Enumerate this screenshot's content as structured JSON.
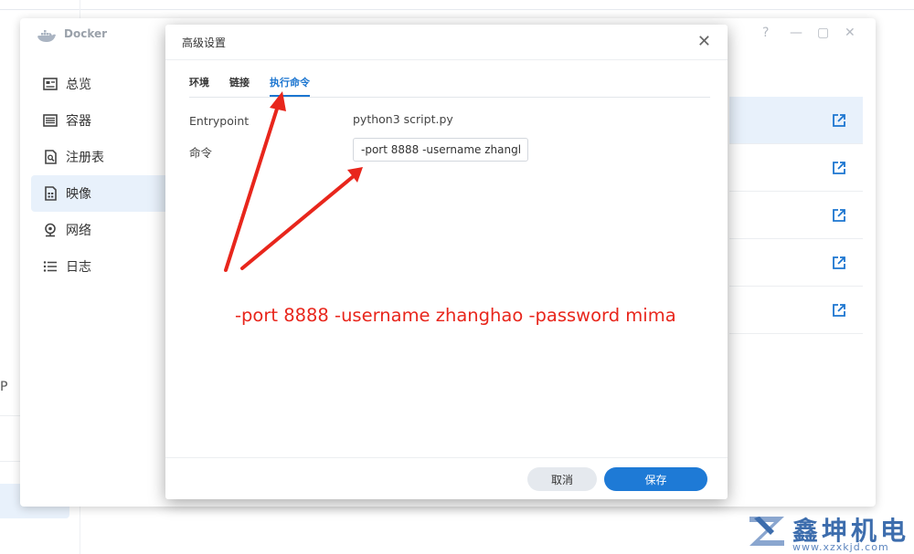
{
  "window": {
    "title": "Docker",
    "controls": [
      "?",
      "—",
      "▢",
      "✕"
    ]
  },
  "sidebar": {
    "items": [
      {
        "label": "总览",
        "icon": "overview-icon"
      },
      {
        "label": "容器",
        "icon": "container-icon"
      },
      {
        "label": "注册表",
        "icon": "registry-icon"
      },
      {
        "label": "映像",
        "icon": "image-icon",
        "active": true
      },
      {
        "label": "网络",
        "icon": "network-icon"
      },
      {
        "label": "日志",
        "icon": "log-icon"
      }
    ]
  },
  "dialog": {
    "title": "高级设置",
    "close": "✕",
    "tabs": [
      {
        "label": "环境"
      },
      {
        "label": "链接"
      },
      {
        "label": "执行命令",
        "active": true
      }
    ],
    "entrypoint_label": "Entrypoint",
    "entrypoint_value": "python3 script.py",
    "command_label": "命令",
    "command_value": "-port 8888 -username zhanghao -password mima",
    "annotation": "-port 8888 -username zhanghao -password mima",
    "cancel_label": "取消",
    "save_label": "保存"
  },
  "background": {
    "left_glyph": "P"
  },
  "watermark": {
    "brand": "鑫坤机电",
    "url": "www.xzxkjd.com"
  },
  "colors": {
    "accent": "#1e7ad6",
    "annotation": "#e8261c",
    "selected_bg": "#e8f1fb"
  }
}
